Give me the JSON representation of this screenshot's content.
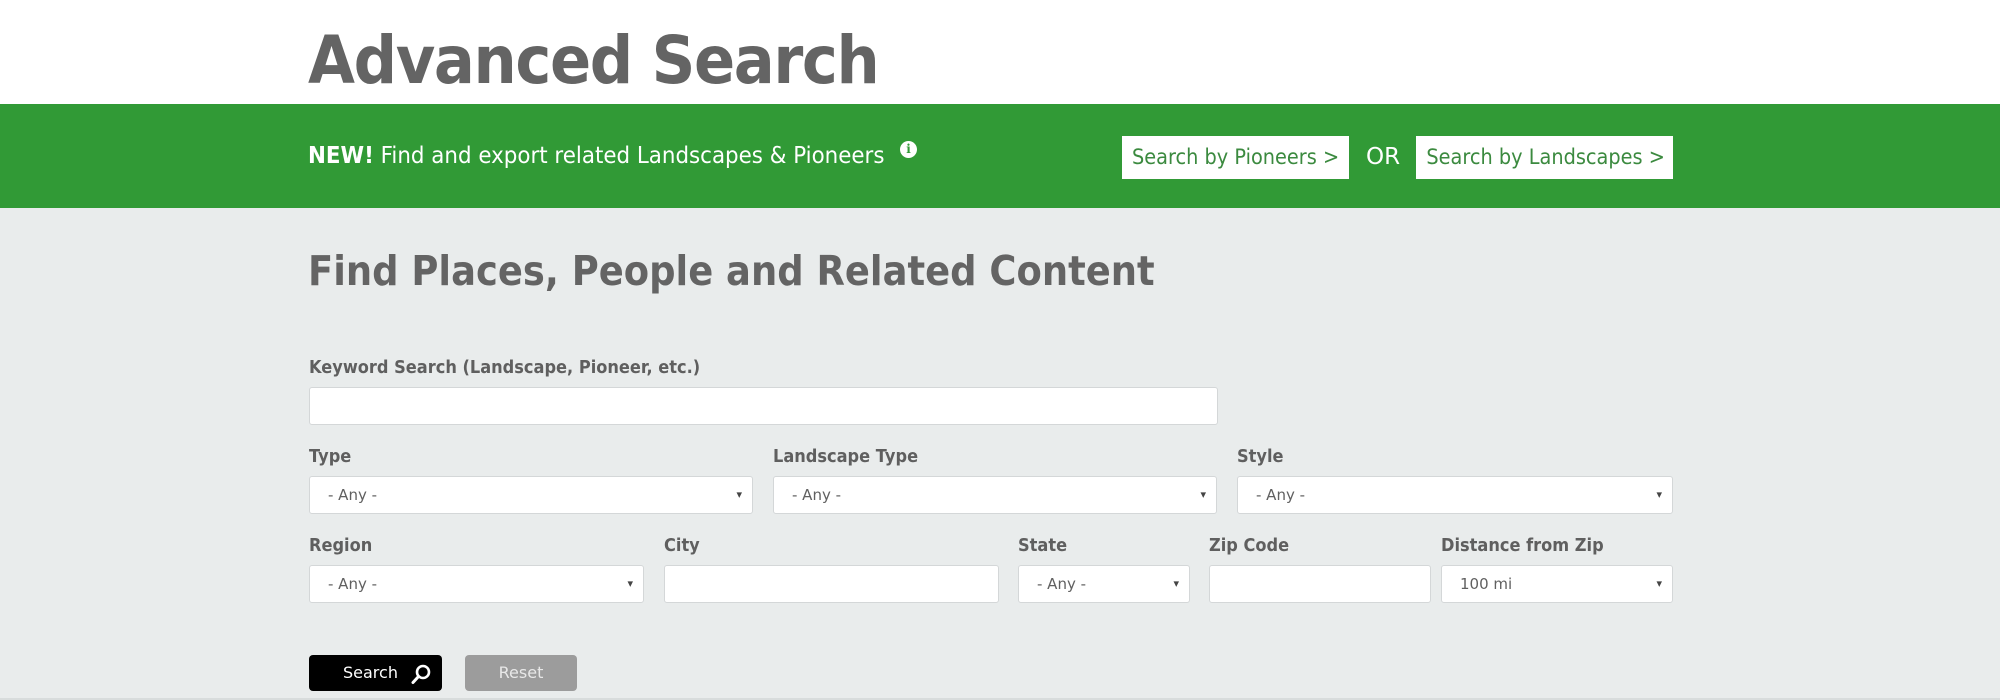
{
  "header": {
    "title": "Advanced Search"
  },
  "banner": {
    "new_label": "NEW!",
    "text": "Find and export related Landscapes & Pioneers",
    "info_icon": "info-circle-icon",
    "pioneers_button": "Search by Pioneers >",
    "or_text": "OR",
    "landscapes_button": "Search by Landscapes >"
  },
  "form": {
    "section_title": "Find Places, People and Related Content",
    "keyword": {
      "label": "Keyword Search (Landscape, Pioneer, etc.)",
      "value": ""
    },
    "type": {
      "label": "Type",
      "value": "- Any -"
    },
    "landscape_type": {
      "label": "Landscape Type",
      "value": "- Any -"
    },
    "style": {
      "label": "Style",
      "value": "- Any -"
    },
    "region": {
      "label": "Region",
      "value": "- Any -"
    },
    "city": {
      "label": "City",
      "value": ""
    },
    "state": {
      "label": "State",
      "value": "- Any -"
    },
    "zip": {
      "label": "Zip Code",
      "value": ""
    },
    "distance": {
      "label": "Distance from Zip",
      "value": "100 mi"
    },
    "caret": "▾",
    "search_button": "Search",
    "search_icon": "magnifier-icon",
    "reset_button": "Reset"
  },
  "colors": {
    "banner_green": "#319a36",
    "button_text_green": "#3b8a3f",
    "page_bg": "#e9ecec",
    "heading_gray": "#646464",
    "search_button_bg": "#000000",
    "reset_button_bg": "#9c9c9c"
  }
}
